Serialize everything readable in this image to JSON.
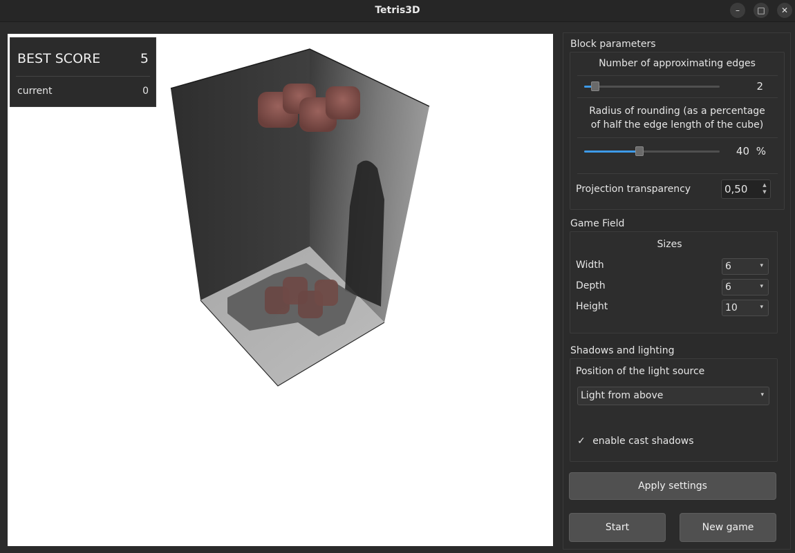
{
  "window": {
    "title": "Tetris3D"
  },
  "controls": {
    "minimize": "–",
    "maximize": "□",
    "close": "✕"
  },
  "score": {
    "best_label": "BEST SCORE",
    "best_value": "5",
    "current_label": "current",
    "current_value": "0"
  },
  "block_parameters": {
    "title": "Block parameters",
    "edges_label": "Number of approximating edges",
    "edges_value": "2",
    "edges_slider_fraction": 0.05,
    "radius_label_line1": "Radius of rounding (as a percentage",
    "radius_label_line2": "of half the edge length of the cube)",
    "radius_value": "40",
    "radius_unit": "%",
    "radius_slider_fraction": 0.4,
    "transparency_label": "Projection transparency",
    "transparency_value": "0,50"
  },
  "game_field": {
    "title": "Game Field",
    "sizes_label": "Sizes",
    "width_label": "Width",
    "width_value": "6",
    "depth_label": "Depth",
    "depth_value": "6",
    "height_label": "Height",
    "height_value": "10"
  },
  "shadows": {
    "title": "Shadows and lighting",
    "light_position_label": "Position of the light source",
    "light_position_value": "Light from above",
    "cast_shadows_label": "enable cast shadows",
    "cast_shadows_checked": true,
    "check_glyph": "✓"
  },
  "buttons": {
    "apply": "Apply settings",
    "start": "Start",
    "new_game": "New game"
  },
  "icons": {
    "dropdown": "▾",
    "spin_up": "▲",
    "spin_down": "▼"
  },
  "colors": {
    "accent": "#3d9ae8",
    "block": "#8a5651"
  }
}
